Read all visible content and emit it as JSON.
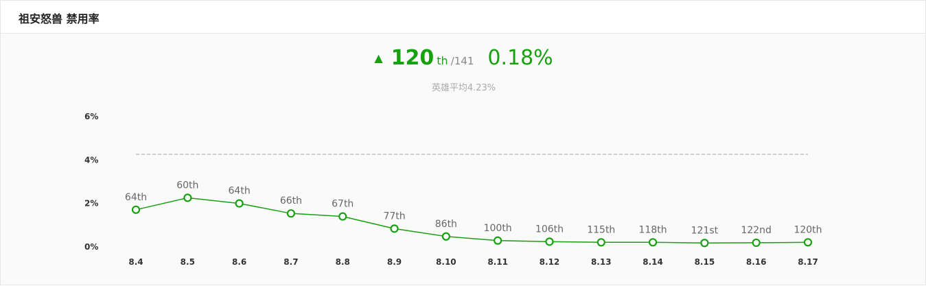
{
  "panel": {
    "title": "祖安怒兽 禁用率"
  },
  "summary": {
    "trend": "up",
    "rank": "120",
    "rank_suffix": "th",
    "rank_total": "/141",
    "rate": "0.18%",
    "average_label": "英雄平均4.23%"
  },
  "colors": {
    "accent": "#17a00f",
    "average_line": "#aaaaaa",
    "label": "#666666"
  },
  "chart_data": {
    "type": "line",
    "title": "",
    "xlabel": "",
    "ylabel": "",
    "ylim": [
      0,
      6
    ],
    "yticks": [
      "0%",
      "2%",
      "4%",
      "6%"
    ],
    "grid": false,
    "categories": [
      "8.4",
      "8.5",
      "8.6",
      "8.7",
      "8.8",
      "8.9",
      "8.10",
      "8.11",
      "8.12",
      "8.13",
      "8.14",
      "8.15",
      "8.16",
      "8.17"
    ],
    "series": [
      {
        "values": [
          1.68,
          2.23,
          1.97,
          1.51,
          1.37,
          0.81,
          0.45,
          0.26,
          0.21,
          0.18,
          0.18,
          0.15,
          0.16,
          0.18
        ],
        "labels": [
          "64th",
          "60th",
          "64th",
          "66th",
          "67th",
          "77th",
          "86th",
          "100th",
          "106th",
          "115th",
          "118th",
          "121st",
          "122nd",
          "120th"
        ]
      }
    ],
    "average": 4.23
  }
}
